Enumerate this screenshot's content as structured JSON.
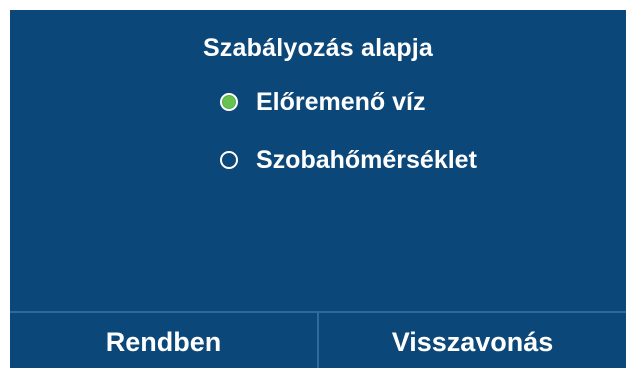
{
  "dialog": {
    "title": "Szabályozás alapja",
    "options": [
      {
        "label": "Előremenő víz",
        "selected": true
      },
      {
        "label": "Szobahőmérséklet",
        "selected": false
      }
    ]
  },
  "footer": {
    "ok_label": "Rendben",
    "cancel_label": "Visszavonás"
  },
  "colors": {
    "background": "#0c4779",
    "accent_selected": "#68c251",
    "text": "#ffffff",
    "divider": "#2f6a9e"
  }
}
